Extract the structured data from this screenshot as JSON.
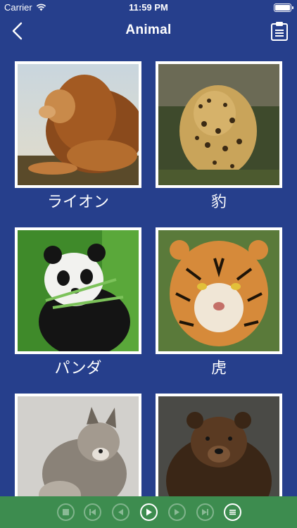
{
  "status": {
    "carrier": "Carrier",
    "time": "11:59 PM"
  },
  "nav": {
    "title": "Animal"
  },
  "animals": [
    {
      "label": "ライオン"
    },
    {
      "label": "豹"
    },
    {
      "label": "パンダ"
    },
    {
      "label": "虎"
    },
    {
      "label": ""
    },
    {
      "label": ""
    }
  ],
  "colors": {
    "background": "#263f8c",
    "toolbar": "#3d8c4f",
    "text": "#ffffff"
  },
  "toolbar": {
    "buttons": [
      "stop-icon",
      "skip-back-icon",
      "rewind-icon",
      "play-icon",
      "forward-icon",
      "skip-forward-icon",
      "list-icon"
    ]
  }
}
